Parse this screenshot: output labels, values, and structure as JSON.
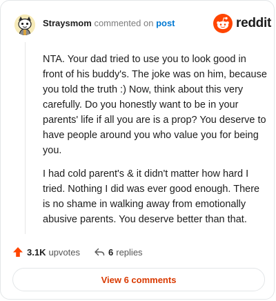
{
  "header": {
    "username": "Straysmom",
    "action": "commented on",
    "target": "post",
    "logo_text": "reddit"
  },
  "comment": {
    "paragraphs": [
      "NTA. Your dad tried to use you to look good in front of his buddy's. The joke was on him, because you told the truth :) Now, think about this very carefully. Do you honestly want to be in your parents' life if all you are is a prop? You deserve to have people around you who value you for being you.",
      "I had cold parent's & it didn't matter how hard I tried. Nothing I did was ever good enough. There is no shame in walking away from emotionally abusive parents. You deserve better than that."
    ]
  },
  "actions": {
    "upvote_count": "3.1K",
    "upvote_label": "upvotes",
    "replies_count": "6",
    "replies_label": "replies"
  },
  "footer": {
    "view_button": "View 6 comments"
  },
  "colors": {
    "brand_orange": "#ff4500",
    "link_blue": "#0079d3",
    "button_text": "#d93900"
  },
  "icons": {
    "avatar": "snoo-avatar-icon",
    "logo": "reddit-snoo-icon",
    "upvote": "upvote-arrow-icon",
    "reply": "reply-arrow-icon"
  }
}
